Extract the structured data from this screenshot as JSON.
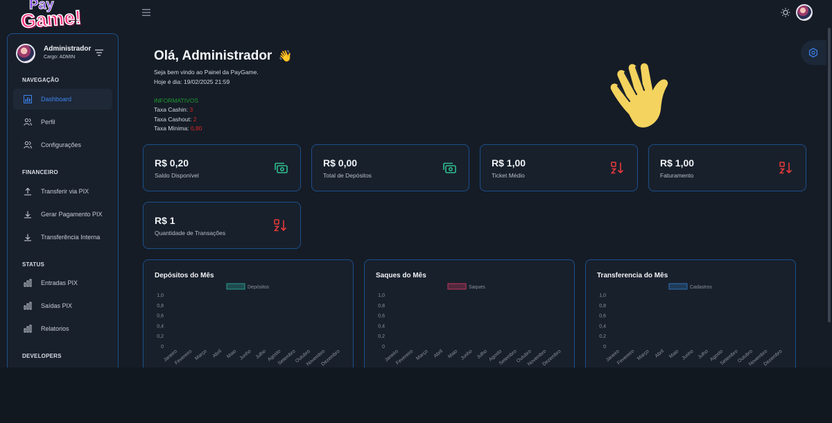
{
  "brand": {
    "line1": "Pay",
    "line2": "Game!"
  },
  "user": {
    "name": "Administrador",
    "role": "Cargo: ADMIN"
  },
  "sidebar": {
    "sections": [
      {
        "title": "NAVEGAÇÃO",
        "items": [
          {
            "label": "Dashboard",
            "icon": "dashboard-icon",
            "active": true
          },
          {
            "label": "Perfil",
            "icon": "users-icon"
          },
          {
            "label": "Configurações",
            "icon": "users-icon"
          }
        ]
      },
      {
        "title": "FINANCEIRO",
        "items": [
          {
            "label": "Transferir via PIX",
            "icon": "upload-icon"
          },
          {
            "label": "Gerar Pagamento PIX",
            "icon": "download-icon"
          },
          {
            "label": "Transferência Interna",
            "icon": "download-icon"
          }
        ]
      },
      {
        "title": "STATUS",
        "items": [
          {
            "label": "Entradas PIX",
            "icon": "bar-chart-icon"
          },
          {
            "label": "Saídas PIX",
            "icon": "bar-chart-icon"
          },
          {
            "label": "Relatorios",
            "icon": "bar-chart-icon"
          }
        ]
      },
      {
        "title": "DEVELOPERS",
        "items": []
      }
    ]
  },
  "greeting": {
    "title": "Olá, Administrador",
    "emoji": "👋",
    "welcome": "Seja bem vindo ao Painel da PayGame.",
    "date": "Hoje é dia: 19/02/2025 21:59"
  },
  "info": {
    "title": "INFORMATIVOS",
    "lines": [
      {
        "label": "Taxa Cashin:",
        "value": "3"
      },
      {
        "label": "Taxa Cashout:",
        "value": "2"
      },
      {
        "label": "Taxa Mínima:",
        "value": "0,80"
      }
    ]
  },
  "cards": [
    {
      "value": "R$ 0,20",
      "label": "Saldo Disponível",
      "icon": "money-icon",
      "color": "#2fbf8f"
    },
    {
      "value": "R$ 0,00",
      "label": "Total de Depósitos",
      "icon": "money-icon",
      "color": "#2fbf8f"
    },
    {
      "value": "R$ 1,00",
      "label": "Ticket Médio",
      "icon": "sort-icon",
      "color": "#e83a3a"
    },
    {
      "value": "R$ 1,00",
      "label": "Faturamento",
      "icon": "sort-icon",
      "color": "#e83a3a"
    },
    {
      "value": "R$ 1",
      "label": "Quantidade de Transações",
      "icon": "sort-icon",
      "color": "#e83a3a"
    }
  ],
  "chart_data": [
    {
      "type": "bar",
      "title": "Depósitos do Mês",
      "legend": "Depósitos",
      "legend_color": "#2a9d8f",
      "categories": [
        "Janeiro",
        "Fevereiro",
        "Março",
        "Abril",
        "Maio",
        "Junho",
        "Julho",
        "Agosto",
        "Setembro",
        "Outubro",
        "Novembro",
        "Dezembro"
      ],
      "y_ticks": [
        "1,0",
        "0,8",
        "0,6",
        "0,4",
        "0,2",
        "0"
      ],
      "ylim": [
        0,
        1
      ],
      "values": [
        0,
        0,
        0,
        0,
        0,
        0,
        0,
        0,
        0,
        0,
        0,
        0
      ],
      "legend_placement": "top"
    },
    {
      "type": "bar",
      "title": "Saques do Mês",
      "legend": "Saques",
      "legend_color": "#c0395d",
      "categories": [
        "Janeiro",
        "Fevereiro",
        "Março",
        "Abril",
        "Maio",
        "Junho",
        "Julho",
        "Agosto",
        "Setembro",
        "Outubro",
        "Novembro",
        "Dezembro"
      ],
      "y_ticks": [
        "1,0",
        "0,8",
        "0,6",
        "0,4",
        "0,2",
        "0"
      ],
      "ylim": [
        0,
        1
      ],
      "values": [
        0,
        0,
        0,
        0,
        0,
        0,
        0,
        0,
        0,
        0,
        0,
        0
      ],
      "legend_placement": "top"
    },
    {
      "type": "bar",
      "title": "Transferencia do Mês",
      "legend": "Cadastros",
      "legend_color": "#2f6fb0",
      "categories": [
        "Janeiro",
        "Fevereiro",
        "Março",
        "Abril",
        "Maio",
        "Junho",
        "Julho",
        "Agosto",
        "Setembro",
        "Outubro",
        "Novembro",
        "Dezembro"
      ],
      "y_ticks": [
        "1,0",
        "0,8",
        "0,6",
        "0,4",
        "0,2",
        "0"
      ],
      "ylim": [
        0,
        1
      ],
      "values": [
        0,
        0,
        0,
        0,
        0,
        0,
        0,
        0,
        0,
        0,
        0,
        0
      ],
      "legend_placement": "top"
    }
  ]
}
